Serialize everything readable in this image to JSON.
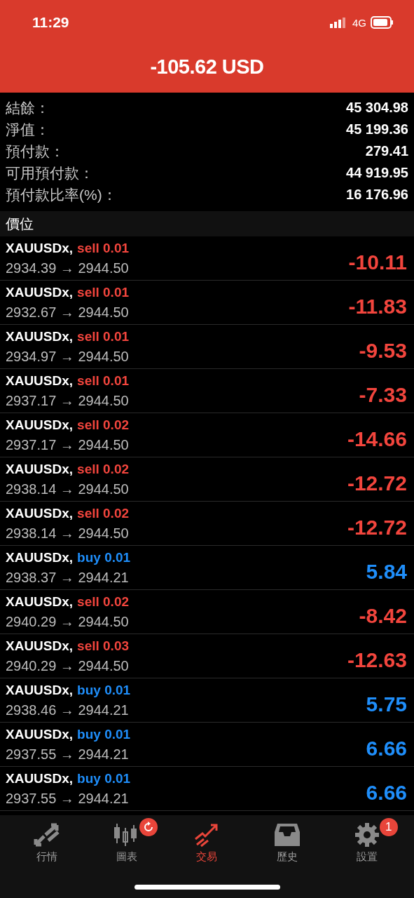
{
  "status_bar": {
    "time": "11:29",
    "network": "4G"
  },
  "header": {
    "profit": "-105.62 USD"
  },
  "summary": [
    {
      "label": "結餘：",
      "value": "45 304.98"
    },
    {
      "label": "淨值：",
      "value": "45 199.36"
    },
    {
      "label": "預付款：",
      "value": "279.41"
    },
    {
      "label": "可用預付款：",
      "value": "44 919.95"
    },
    {
      "label": "預付款比率(%)：",
      "value": "16 176.96"
    }
  ],
  "section_title": "價位",
  "positions": [
    {
      "symbol": "XAUUSDx,",
      "kind": "sell",
      "order": "sell 0.01",
      "prices": "2934.39 → 2944.50",
      "profit": "-10.11"
    },
    {
      "symbol": "XAUUSDx,",
      "kind": "sell",
      "order": "sell 0.01",
      "prices": "2932.67 → 2944.50",
      "profit": "-11.83"
    },
    {
      "symbol": "XAUUSDx,",
      "kind": "sell",
      "order": "sell 0.01",
      "prices": "2934.97 → 2944.50",
      "profit": "-9.53"
    },
    {
      "symbol": "XAUUSDx,",
      "kind": "sell",
      "order": "sell 0.01",
      "prices": "2937.17 → 2944.50",
      "profit": "-7.33"
    },
    {
      "symbol": "XAUUSDx,",
      "kind": "sell",
      "order": "sell 0.02",
      "prices": "2937.17 → 2944.50",
      "profit": "-14.66"
    },
    {
      "symbol": "XAUUSDx,",
      "kind": "sell",
      "order": "sell 0.02",
      "prices": "2938.14 → 2944.50",
      "profit": "-12.72"
    },
    {
      "symbol": "XAUUSDx,",
      "kind": "sell",
      "order": "sell 0.02",
      "prices": "2938.14 → 2944.50",
      "profit": "-12.72"
    },
    {
      "symbol": "XAUUSDx,",
      "kind": "buy",
      "order": "buy 0.01",
      "prices": "2938.37 → 2944.21",
      "profit": "5.84"
    },
    {
      "symbol": "XAUUSDx,",
      "kind": "sell",
      "order": "sell 0.02",
      "prices": "2940.29 → 2944.50",
      "profit": "-8.42"
    },
    {
      "symbol": "XAUUSDx,",
      "kind": "sell",
      "order": "sell 0.03",
      "prices": "2940.29 → 2944.50",
      "profit": "-12.63"
    },
    {
      "symbol": "XAUUSDx,",
      "kind": "buy",
      "order": "buy 0.01",
      "prices": "2938.46 → 2944.21",
      "profit": "5.75"
    },
    {
      "symbol": "XAUUSDx,",
      "kind": "buy",
      "order": "buy 0.01",
      "prices": "2937.55 → 2944.21",
      "profit": "6.66"
    },
    {
      "symbol": "XAUUSDx,",
      "kind": "buy",
      "order": "buy 0.01",
      "prices": "2937.55 → 2944.21",
      "profit": "6.66"
    }
  ],
  "tabs": [
    {
      "label": "行情",
      "selected": false,
      "refresh_badge": false
    },
    {
      "label": "圖表",
      "selected": false,
      "refresh_badge": true
    },
    {
      "label": "交易",
      "selected": true,
      "refresh_badge": false
    },
    {
      "label": "歷史",
      "selected": false,
      "refresh_badge": false
    },
    {
      "label": "設置",
      "selected": false,
      "refresh_badge": false,
      "badge": "1"
    }
  ]
}
